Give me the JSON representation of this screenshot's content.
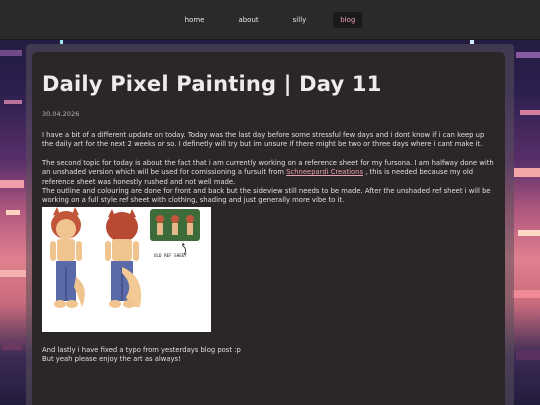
{
  "nav": {
    "items": [
      {
        "label": "home",
        "active": false
      },
      {
        "label": "about",
        "active": false
      },
      {
        "label": "silly",
        "active": false
      },
      {
        "label": "blog",
        "active": true
      }
    ]
  },
  "post": {
    "title": "Daily Pixel Painting | Day 11",
    "date": "30.04.2026",
    "p1": "I have a bit of a different update on today. Today was the last day before some stressful few days and i dont know if i can keep up the daily art for the next 2 weeks or so. I definetly will try but im unsure if there might be two or three days where i cant make it.",
    "p2_before_link": "The second topic for today is about the fact that i am currently working on a reference sheet for my fursona. I am halfway done with an unshaded version which will be used for comissioning a fursuit from ",
    "p2_link": "Schneepardi Creations",
    "p2_after_link": " , this is needed because my old reference sheet was honestly rushed and not well made.",
    "p3": "The outline and colouring are done for front and back but the sideview still needs to be made. After the unshaded ref sheet i will be working on a full style ref sheet with clothing, shading and just generally more vibe to it.",
    "image_caption": "OLD REF SHEET",
    "p4": "And lastly i have fixed a typo from yesterdays blog post :p",
    "p5": "But yeah please enjoy the art as always!"
  },
  "colors": {
    "accent": "#e8a0b0",
    "card_bg": "#2b2628",
    "nav_bg": "#2a2a2a"
  }
}
